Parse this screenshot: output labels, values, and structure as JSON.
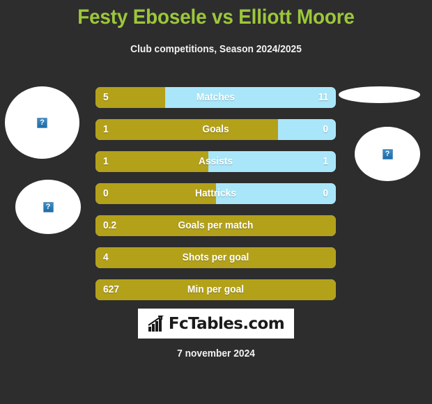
{
  "header": {
    "title": "Festy Ebosele vs Elliott Moore",
    "subtitle": "Club competitions, Season 2024/2025",
    "title_color": "#9cc73a"
  },
  "players": {
    "left": {
      "photo_top_alt": "?",
      "photo_bottom_alt": "?"
    },
    "right": {
      "photo_top_alt": "",
      "photo_bottom_alt": "?"
    }
  },
  "colors": {
    "background": "#2d2d2d",
    "left_player": "#b3a11a",
    "right_player": "#aae6fa",
    "text": "#ffffff"
  },
  "chart_data": {
    "type": "bar",
    "title": "Festy Ebosele vs Elliott Moore",
    "subtitle": "Club competitions, Season 2024/2025",
    "orientation": "horizontal",
    "legend": [
      "Festy Ebosele",
      "Elliott Moore"
    ],
    "categories": [
      "Matches",
      "Goals",
      "Assists",
      "Hattricks",
      "Goals per match",
      "Shots per goal",
      "Min per goal"
    ],
    "series": [
      {
        "name": "Festy Ebosele",
        "color": "#b3a11a",
        "values": [
          "5",
          "1",
          "1",
          "0",
          "0.2",
          "4",
          "627"
        ]
      },
      {
        "name": "Elliott Moore",
        "color": "#aae6fa",
        "values": [
          "11",
          "0",
          "1",
          "0",
          null,
          null,
          null
        ]
      }
    ],
    "fill_percent": [
      29,
      76,
      47,
      50,
      100,
      100,
      100
    ]
  },
  "rows": [
    {
      "label": "Matches",
      "left": "5",
      "right": "11",
      "fill": 29,
      "split": true
    },
    {
      "label": "Goals",
      "left": "1",
      "right": "0",
      "fill": 76,
      "split": true
    },
    {
      "label": "Assists",
      "left": "1",
      "right": "1",
      "fill": 47,
      "split": true
    },
    {
      "label": "Hattricks",
      "left": "0",
      "right": "0",
      "fill": 50,
      "split": true
    },
    {
      "label": "Goals per match",
      "left": "0.2",
      "right": "",
      "fill": 100,
      "split": false
    },
    {
      "label": "Shots per goal",
      "left": "4",
      "right": "",
      "fill": 100,
      "split": false
    },
    {
      "label": "Min per goal",
      "left": "627",
      "right": "",
      "fill": 100,
      "split": false
    }
  ],
  "footer": {
    "logo_text": "FcTables.com",
    "logo_icon": "bar-chart-icon",
    "date": "7 november 2024"
  }
}
